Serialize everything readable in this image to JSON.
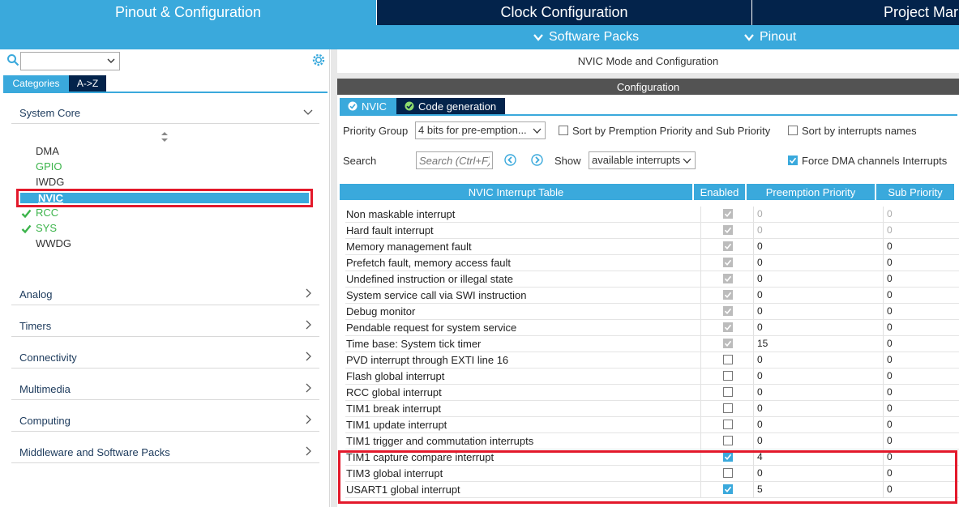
{
  "top_tabs": [
    "Pinout & Configuration",
    "Clock Configuration",
    "Project Mar"
  ],
  "subbar": {
    "software_packs": "Software Packs",
    "pinout": "Pinout"
  },
  "left": {
    "search_value": "",
    "subtabs": [
      "Categories",
      "A->Z"
    ],
    "sections": [
      "System Core",
      "Analog",
      "Timers",
      "Connectivity",
      "Multimedia",
      "Computing",
      "Middleware and Software Packs"
    ],
    "system_core_items": [
      {
        "label": "DMA",
        "state": "normal"
      },
      {
        "label": "GPIO",
        "state": "green"
      },
      {
        "label": "IWDG",
        "state": "normal"
      },
      {
        "label": "NVIC",
        "state": "selected"
      },
      {
        "label": "RCC",
        "state": "checked"
      },
      {
        "label": "SYS",
        "state": "checked"
      },
      {
        "label": "WWDG",
        "state": "normal"
      }
    ]
  },
  "right": {
    "mode_title": "NVIC Mode and Configuration",
    "config_header": "Configuration",
    "tabs": [
      "NVIC",
      "Code generation"
    ],
    "priority_group_label": "Priority Group",
    "priority_group_value": "4 bits for pre-emption...",
    "sort_premption_label": "Sort by Premption Priority and Sub Priority",
    "sort_names_label": "Sort by interrupts names",
    "search_label": "Search",
    "search_placeholder": "Search (Ctrl+F)",
    "show_label": "Show",
    "show_value": "available interrupts",
    "force_dma_label": "Force DMA channels Interrupts",
    "table": {
      "headers": [
        "NVIC Interrupt Table",
        "Enabled",
        "Preemption Priority",
        "Sub Priority"
      ],
      "rows": [
        {
          "name": "Non maskable interrupt",
          "enabled": "locked",
          "preemption": "0",
          "sub": "0",
          "dim": true
        },
        {
          "name": "Hard fault interrupt",
          "enabled": "locked",
          "preemption": "0",
          "sub": "0",
          "dim": true
        },
        {
          "name": "Memory management fault",
          "enabled": "locked",
          "preemption": "0",
          "sub": "0",
          "dim": false
        },
        {
          "name": "Prefetch fault, memory access fault",
          "enabled": "locked",
          "preemption": "0",
          "sub": "0",
          "dim": false
        },
        {
          "name": "Undefined instruction or illegal state",
          "enabled": "locked",
          "preemption": "0",
          "sub": "0",
          "dim": false
        },
        {
          "name": "System service call via SWI instruction",
          "enabled": "locked",
          "preemption": "0",
          "sub": "0",
          "dim": false
        },
        {
          "name": "Debug monitor",
          "enabled": "locked",
          "preemption": "0",
          "sub": "0",
          "dim": false
        },
        {
          "name": "Pendable request for system service",
          "enabled": "locked",
          "preemption": "0",
          "sub": "0",
          "dim": false
        },
        {
          "name": "Time base: System tick timer",
          "enabled": "locked",
          "preemption": "15",
          "sub": "0",
          "dim": false
        },
        {
          "name": "PVD interrupt through EXTI line 16",
          "enabled": "off",
          "preemption": "0",
          "sub": "0",
          "dim": false
        },
        {
          "name": "Flash global interrupt",
          "enabled": "off",
          "preemption": "0",
          "sub": "0",
          "dim": false
        },
        {
          "name": "RCC global interrupt",
          "enabled": "off",
          "preemption": "0",
          "sub": "0",
          "dim": false
        },
        {
          "name": "TIM1 break interrupt",
          "enabled": "off",
          "preemption": "0",
          "sub": "0",
          "dim": false
        },
        {
          "name": "TIM1 update interrupt",
          "enabled": "off",
          "preemption": "0",
          "sub": "0",
          "dim": false
        },
        {
          "name": "TIM1 trigger and commutation interrupts",
          "enabled": "off",
          "preemption": "0",
          "sub": "0",
          "dim": false
        },
        {
          "name": "TIM1 capture compare interrupt",
          "enabled": "on",
          "preemption": "4",
          "sub": "0",
          "dim": false
        },
        {
          "name": "TIM3 global interrupt",
          "enabled": "off",
          "preemption": "0",
          "sub": "0",
          "dim": false
        },
        {
          "name": "USART1 global interrupt",
          "enabled": "on",
          "preemption": "5",
          "sub": "0",
          "dim": false
        }
      ]
    }
  },
  "colors": {
    "accent": "#3aa9dc",
    "navy": "#03234b",
    "highlight": "#e3192b",
    "green": "#3cb44b"
  }
}
